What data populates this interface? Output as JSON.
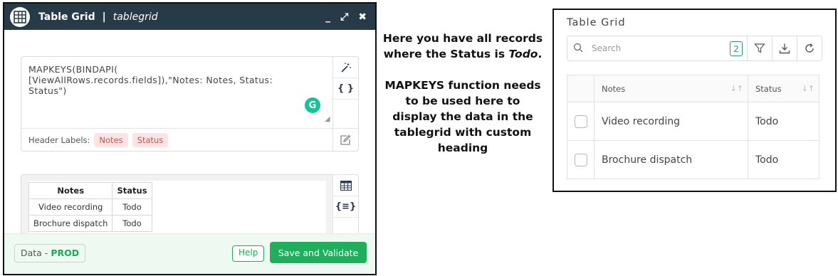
{
  "dialog": {
    "title": "Table Grid",
    "separator": "|",
    "subtitle": "tablegrid",
    "icons": {
      "app": "table-icon",
      "minimize": "minimize-icon",
      "expand": "expand-icon",
      "close": "close-icon"
    },
    "controls": {
      "minimize": "_",
      "expand": "⤢",
      "close": "✖"
    },
    "formula": "MAPKEYS(BINDAPI(\n[ViewAllRows.records.fields]),\"Notes: Notes, Status:\nStatus\")",
    "side_buttons": {
      "magic": "magic-wand-icon",
      "braces": "{ }"
    },
    "header_labels_caption": "Header Labels:",
    "header_labels": [
      "Notes",
      "Status"
    ],
    "preview": {
      "columns": [
        "Notes",
        "Status"
      ],
      "rows": [
        [
          "Video recording",
          "Todo"
        ],
        [
          "Brochure dispatch",
          "Todo"
        ]
      ],
      "side_icons": {
        "table": "table-icon",
        "json": "{≡}"
      }
    },
    "footer": {
      "env_label": "Data - ",
      "env_value": "PROD",
      "help": "Help",
      "save": "Save and Validate"
    }
  },
  "annotation": {
    "line1a": "Here you have all records where the Status is ",
    "line1b": "Todo",
    "line1c": ".",
    "line2": "MAPKEYS function needs to be used here to display the data in the tablegrid with custom heading"
  },
  "card": {
    "title": "Table Grid",
    "search_placeholder": "Search",
    "count": "2",
    "icons": {
      "search": "search-icon",
      "filter": "filter-icon",
      "download": "download-icon",
      "refresh": "refresh-icon"
    },
    "columns": [
      "Notes",
      "Status"
    ],
    "rows": [
      {
        "notes": "Video recording",
        "status": "Todo"
      },
      {
        "notes": "Brochure dispatch",
        "status": "Todo"
      }
    ],
    "colors": {
      "accent": "#1fae5b",
      "header": "#263a47"
    }
  }
}
